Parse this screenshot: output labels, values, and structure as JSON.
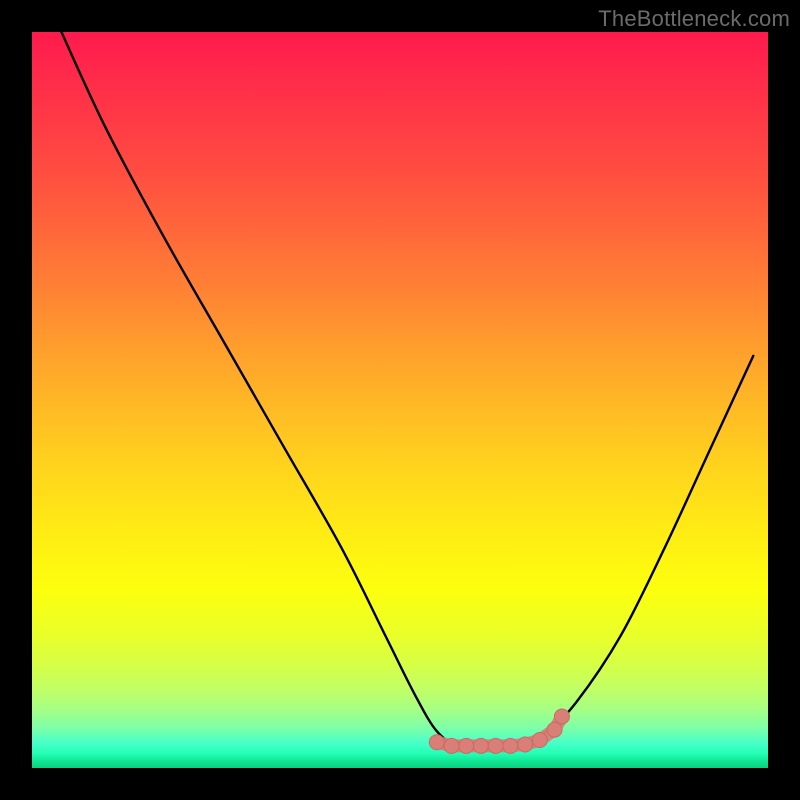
{
  "attribution": "TheBottleneck.com",
  "colors": {
    "frame": "#000000",
    "curve": "#000000",
    "marker_fill": "#d97f78",
    "marker_stroke": "#c96b63",
    "gradient_top": "#ff1a4d",
    "gradient_mid": "#ffd61c",
    "gradient_bottom": "#0bcf7f"
  },
  "chart_data": {
    "type": "line",
    "title": "",
    "xlabel": "",
    "ylabel": "",
    "xlim": [
      0,
      100
    ],
    "ylim": [
      0,
      100
    ],
    "grid": false,
    "legend": false,
    "series": [
      {
        "name": "bottleneck-curve",
        "x": [
          4,
          10,
          18,
          26,
          34,
          42,
          48,
          52,
          55,
          58,
          62,
          66,
          70,
          74,
          80,
          86,
          92,
          98
        ],
        "y": [
          100,
          87,
          72,
          58,
          44,
          30,
          18,
          10,
          5,
          3,
          3,
          3,
          5,
          9,
          18,
          30,
          43,
          56
        ]
      }
    ],
    "annotations": [
      {
        "name": "optimal-range",
        "type": "marker-cluster",
        "x": [
          55,
          57,
          59,
          61,
          63,
          65,
          67,
          69,
          71,
          72
        ],
        "y": [
          3.5,
          3,
          3,
          3,
          3,
          3,
          3.2,
          3.8,
          5.2,
          7
        ]
      }
    ]
  }
}
